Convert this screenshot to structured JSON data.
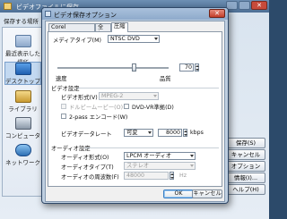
{
  "background_dialog": {
    "title": "ビデオファイルに保存",
    "save_in_label": "保存する場所",
    "places": [
      {
        "label": "最近表示した場所"
      },
      {
        "label": "デスクトップ"
      },
      {
        "label": "ライブラリ"
      },
      {
        "label": "コンピューター"
      },
      {
        "label": "ネットワーク"
      }
    ],
    "side_buttons": {
      "save": "保存(S)",
      "cancel": "キャンセル",
      "options": "オプション(O)...",
      "info": "情報(I)...",
      "help": "ヘルプ(H)"
    },
    "close_glyph": "✕"
  },
  "dialog": {
    "title": "ビデオ保存オプション",
    "close_glyph": "✕",
    "tabs": [
      {
        "label": "Corel VideoStudio"
      },
      {
        "label": "全般"
      },
      {
        "label": "圧縮"
      }
    ],
    "media_type": {
      "label": "メディアタイプ(M)",
      "value": "NTSC DVD"
    },
    "quality": {
      "value": "70",
      "percent": 70,
      "left_label": "速度",
      "right_label": "品質"
    },
    "video_settings": {
      "header": "ビデオ設定",
      "format": {
        "label": "ビデオ形式(V)",
        "value": "MPEG-2"
      },
      "dolby_label": "ドルビームービー(O)",
      "dvd_vr_label": "DVD-VR準拠(D)",
      "two_pass_label": "2-pass エンコード(W)",
      "data_rate": {
        "label": "ビデオデータレート",
        "mode": "可変",
        "value": "8000",
        "unit": "kbps"
      }
    },
    "audio_settings": {
      "header": "オーディオ設定",
      "format": {
        "label": "オーディオ形式(O)",
        "value": "LPCM オーディオ"
      },
      "type": {
        "label": "オーディオタイプ(T)",
        "value": "ステレオ"
      },
      "frequency": {
        "label": "オーディオの周波数(F)",
        "value": "48000",
        "unit": "Hz"
      }
    },
    "buttons": {
      "ok": "OK",
      "cancel": "キャンセル"
    }
  },
  "colors": {
    "accent": "#3b7fc4",
    "title_bar": "#8eaacb",
    "close": "#c33e2a"
  }
}
